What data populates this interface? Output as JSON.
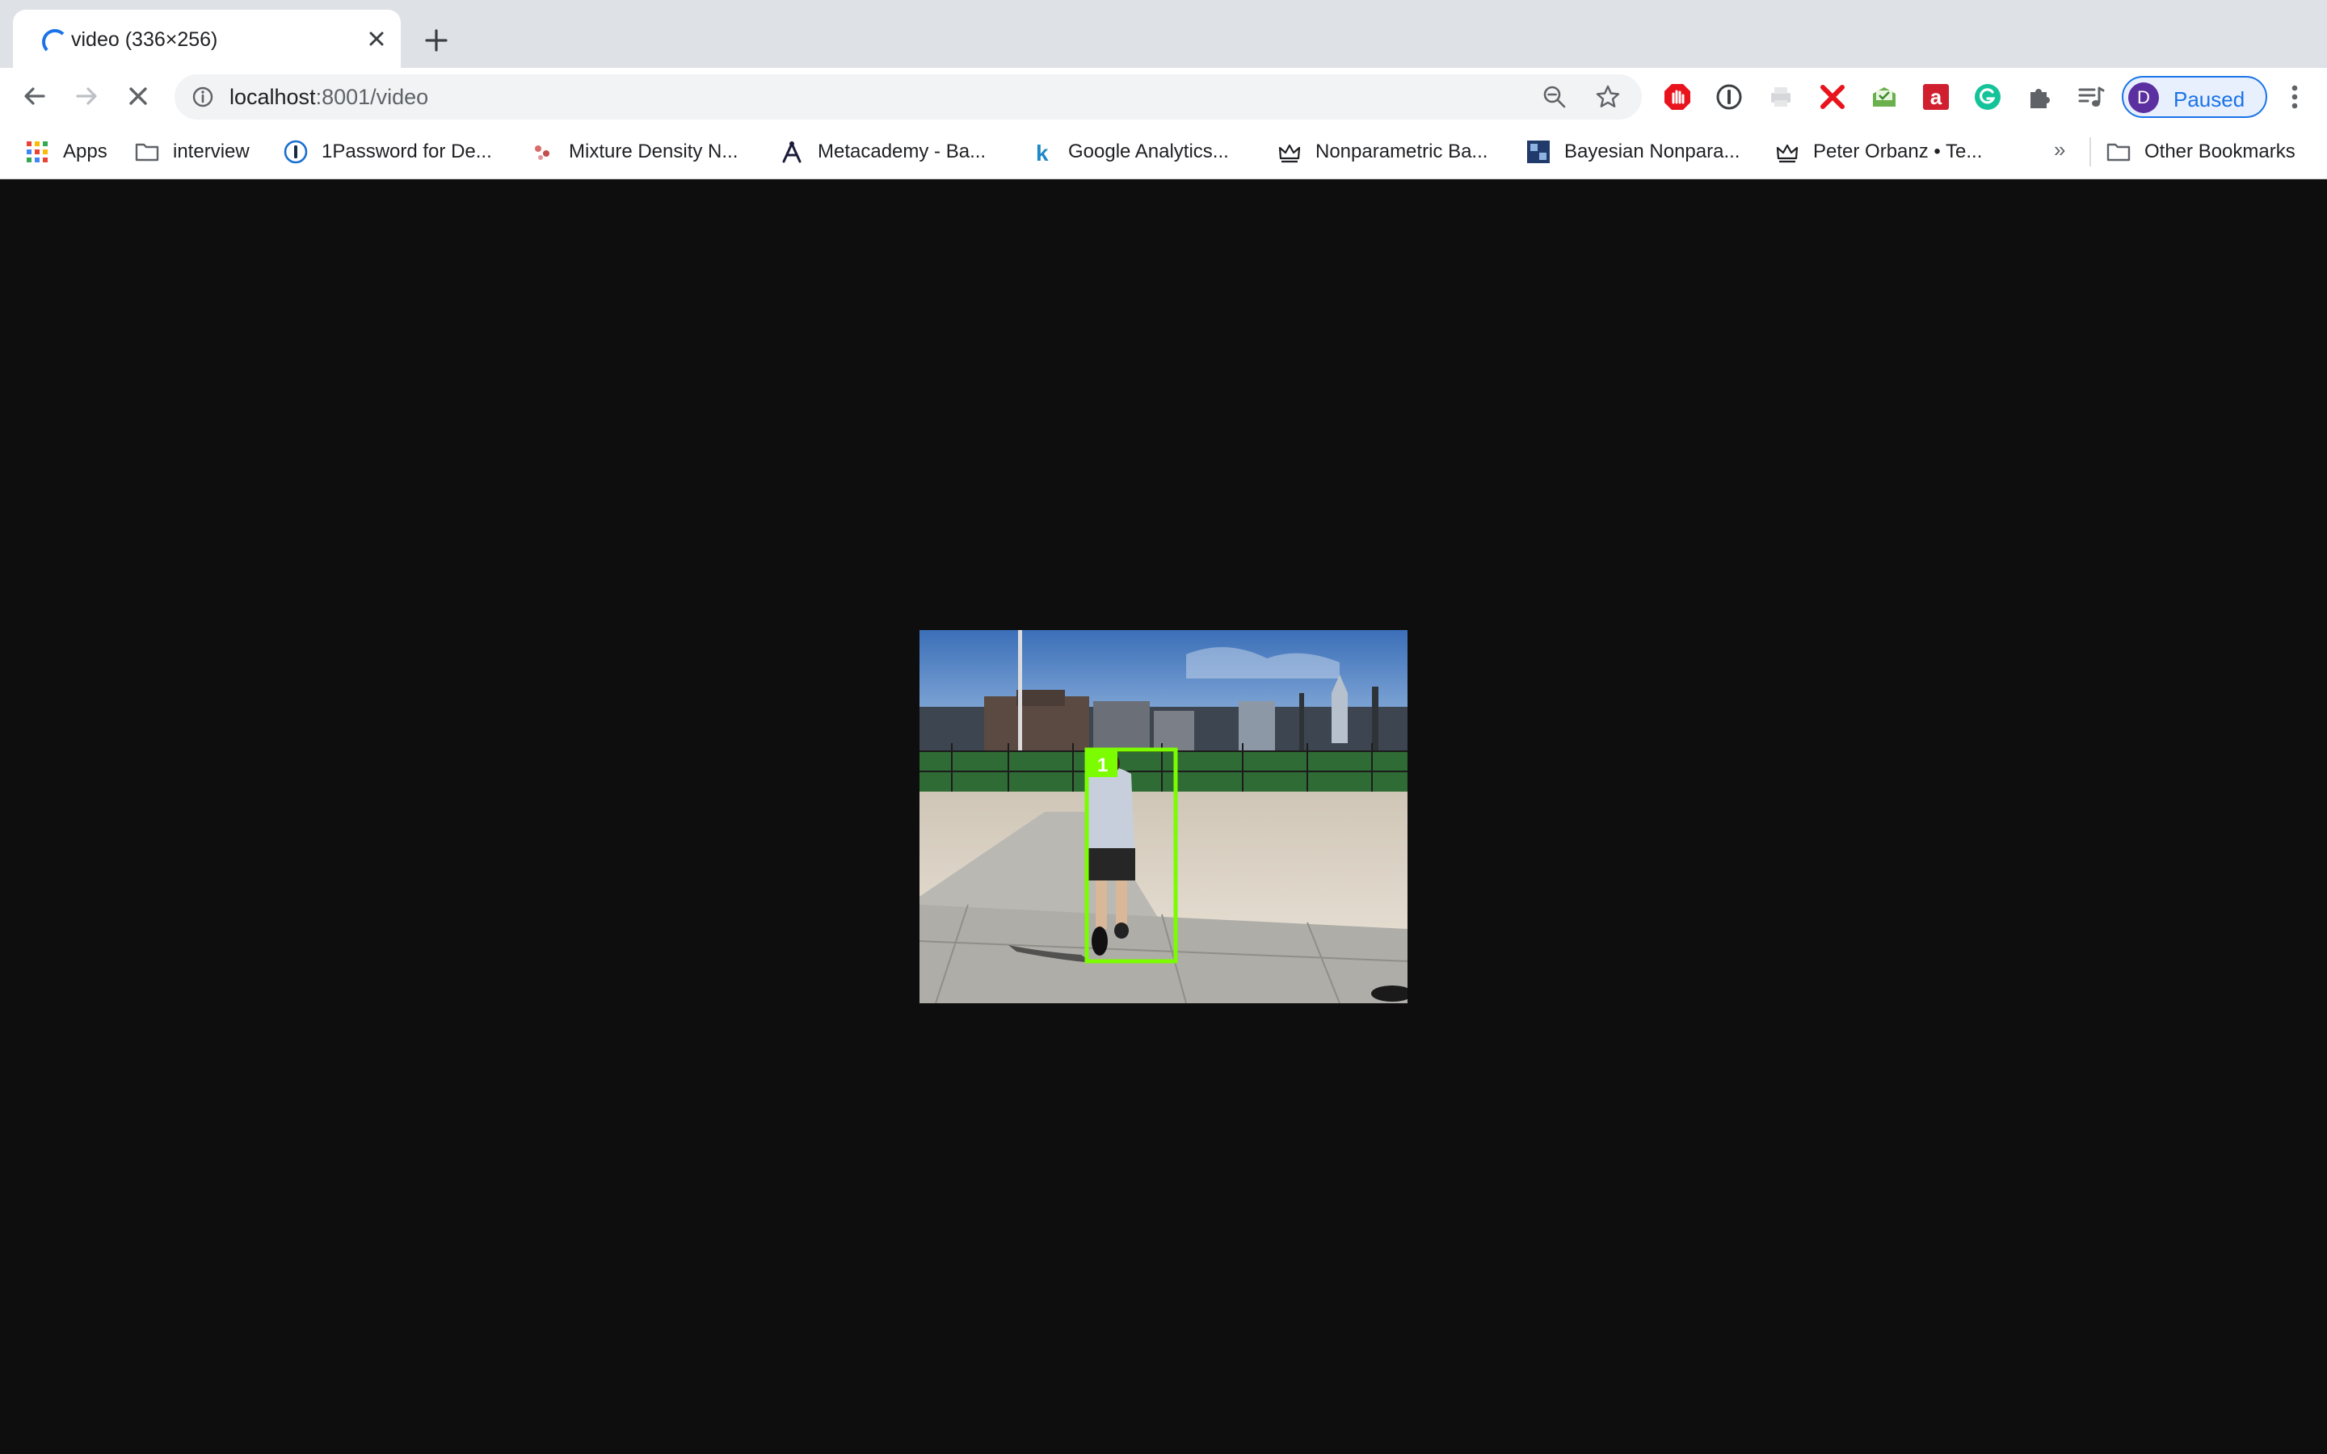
{
  "tab": {
    "title": "video (336×256)",
    "loading": true
  },
  "toolbar": {
    "url_host": "localhost",
    "url_rest": ":8001/video",
    "profile_initial": "D",
    "profile_status": "Paused"
  },
  "bookmarks": {
    "items": [
      {
        "label": "Apps",
        "icon": "apps-grid-icon"
      },
      {
        "label": "interview",
        "icon": "folder-icon"
      },
      {
        "label": "1Password for De...",
        "icon": "1password-icon"
      },
      {
        "label": "Mixture Density N...",
        "icon": "mixture-density-icon"
      },
      {
        "label": "Metacademy - Ba...",
        "icon": "metacademy-icon"
      },
      {
        "label": "Google Analytics...",
        "icon": "k-icon"
      },
      {
        "label": "Nonparametric Ba...",
        "icon": "crown-icon"
      },
      {
        "label": "Bayesian Nonpara...",
        "icon": "bayesian-site-icon"
      },
      {
        "label": "Peter Orbanz • Te...",
        "icon": "crown-icon"
      }
    ],
    "overflow": "»",
    "other": "Other Bookmarks"
  },
  "video": {
    "track_label": "1",
    "box_color": "#7cfc00"
  },
  "colors": {
    "accent": "#1a73e8",
    "page_bg": "#0e0e0e"
  }
}
